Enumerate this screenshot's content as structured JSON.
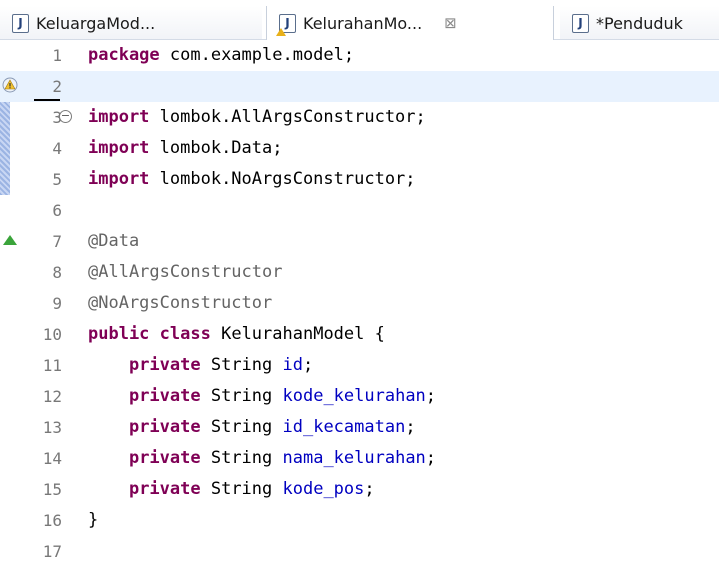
{
  "tabs": [
    {
      "label": "KeluargaMod...",
      "active": false
    },
    {
      "label": "KelurahanMo...",
      "active": true,
      "close": "⊠"
    },
    {
      "label": "*Penduduk",
      "active": false
    }
  ],
  "editor": {
    "lines": [
      {
        "n": "1",
        "tokens": [
          {
            "t": "package",
            "c": "kw"
          },
          {
            "t": " com.example.model;",
            "c": ""
          }
        ]
      },
      {
        "n": "2",
        "tokens": []
      },
      {
        "n": "3",
        "tokens": [
          {
            "t": "import",
            "c": "kw"
          },
          {
            "t": " lombok.AllArgsConstructor;",
            "c": ""
          }
        ]
      },
      {
        "n": "4",
        "tokens": [
          {
            "t": "import",
            "c": "kw"
          },
          {
            "t": " lombok.Data;",
            "c": ""
          }
        ]
      },
      {
        "n": "5",
        "tokens": [
          {
            "t": "import",
            "c": "kw"
          },
          {
            "t": " lombok.NoArgsConstructor;",
            "c": ""
          }
        ]
      },
      {
        "n": "6",
        "tokens": []
      },
      {
        "n": "7",
        "tokens": [
          {
            "t": "@Data",
            "c": "ann"
          }
        ]
      },
      {
        "n": "8",
        "tokens": [
          {
            "t": "@AllArgsConstructor",
            "c": "ann"
          }
        ]
      },
      {
        "n": "9",
        "tokens": [
          {
            "t": "@NoArgsConstructor",
            "c": "ann"
          }
        ]
      },
      {
        "n": "10",
        "tokens": [
          {
            "t": "public",
            "c": "kw"
          },
          {
            "t": " ",
            "c": ""
          },
          {
            "t": "class",
            "c": "kw"
          },
          {
            "t": " KelurahanModel {",
            "c": ""
          }
        ]
      },
      {
        "n": "11",
        "tokens": [
          {
            "t": "    ",
            "c": ""
          },
          {
            "t": "private",
            "c": "kw"
          },
          {
            "t": " String ",
            "c": ""
          },
          {
            "t": "id",
            "c": "fld"
          },
          {
            "t": ";",
            "c": ""
          }
        ]
      },
      {
        "n": "12",
        "tokens": [
          {
            "t": "    ",
            "c": ""
          },
          {
            "t": "private",
            "c": "kw"
          },
          {
            "t": " String ",
            "c": ""
          },
          {
            "t": "kode_kelurahan",
            "c": "fld"
          },
          {
            "t": ";",
            "c": ""
          }
        ]
      },
      {
        "n": "13",
        "tokens": [
          {
            "t": "    ",
            "c": ""
          },
          {
            "t": "private",
            "c": "kw"
          },
          {
            "t": " String ",
            "c": ""
          },
          {
            "t": "id_kecamatan",
            "c": "fld"
          },
          {
            "t": ";",
            "c": ""
          }
        ]
      },
      {
        "n": "14",
        "tokens": [
          {
            "t": "    ",
            "c": ""
          },
          {
            "t": "private",
            "c": "kw"
          },
          {
            "t": " String ",
            "c": ""
          },
          {
            "t": "nama_kelurahan",
            "c": "fld"
          },
          {
            "t": ";",
            "c": ""
          }
        ]
      },
      {
        "n": "15",
        "tokens": [
          {
            "t": "    ",
            "c": ""
          },
          {
            "t": "private",
            "c": "kw"
          },
          {
            "t": " String ",
            "c": ""
          },
          {
            "t": "kode_pos",
            "c": "fld"
          },
          {
            "t": ";",
            "c": ""
          }
        ]
      },
      {
        "n": "16",
        "tokens": [
          {
            "t": "}",
            "c": ""
          }
        ]
      },
      {
        "n": "17",
        "tokens": []
      }
    ]
  },
  "colors": {
    "keyword": "#7f0055",
    "annotation": "#646464",
    "field": "#0000c0",
    "line_number": "#787878",
    "current_line": "#e8f2fe"
  },
  "icons": {
    "file": "java-file-icon",
    "close": "close-icon",
    "fold": "fold-collapse-icon",
    "warning": "warning-marker-icon",
    "override": "override-marker-icon"
  }
}
